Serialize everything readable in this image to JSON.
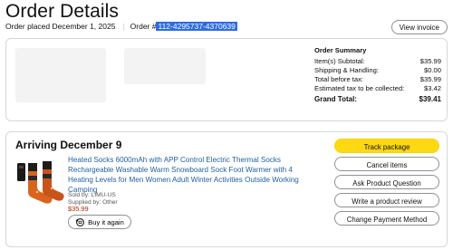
{
  "header": {
    "title": "Order Details",
    "order_placed_label": "Order placed December 1, 2025",
    "order_number_prefix": "Order #",
    "order_number": "112-4295737-4370639",
    "view_invoice_label": "View invoice"
  },
  "summary": {
    "heading": "Order Summary",
    "rows": [
      {
        "label": "Item(s) Subtotal:",
        "value": "$35.99"
      },
      {
        "label": "Shipping & Handling:",
        "value": "$0.00"
      },
      {
        "label": "Total before tax:",
        "value": "$35.99"
      },
      {
        "label": "Estimated tax to be collected:",
        "value": "$3.42"
      }
    ],
    "grand_total_label": "Grand Total:",
    "grand_total_value": "$39.41"
  },
  "shipment": {
    "arriving_label": "Arriving December 9",
    "product_title": "Heated Socks 6000mAh with APP Control Electric Thermal Socks Rechargeable Washable Warm Snowboard Sock Foot Warmer with 4 Heating Levels for Men Women Adult Winter Activities Outside Working Camping",
    "sold_by": "Sold by: LIMU-US",
    "supplied_by": "Supplied by: Other",
    "price": "$35.99",
    "buy_again_label": "Buy it again",
    "buy_again_icon": "reorder-icon",
    "actions": {
      "track": "Track package",
      "cancel": "Cancel items",
      "ask": "Ask Product Question",
      "review": "Write a product review",
      "payment": "Change Payment Method"
    }
  },
  "colors": {
    "link": "#2162a1",
    "primary_button": "#ffd814",
    "price": "#b12704",
    "selection": "#2f6be4"
  }
}
